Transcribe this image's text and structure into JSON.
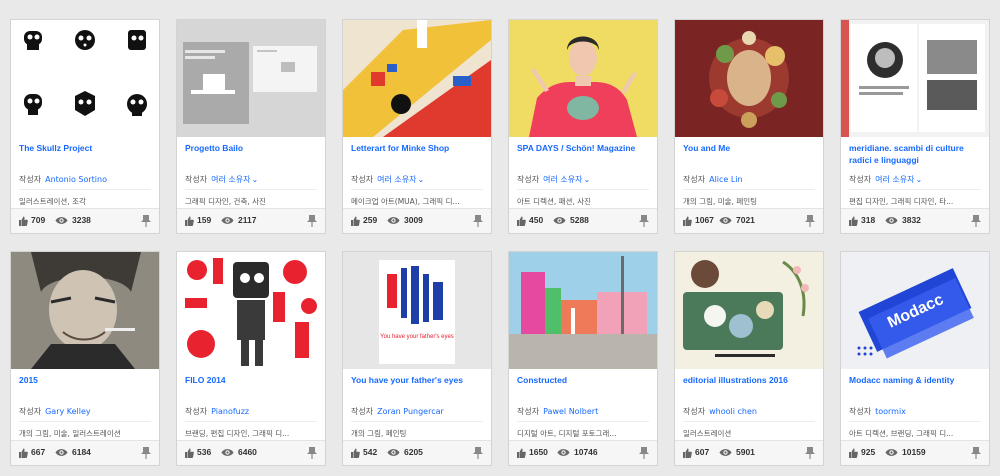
{
  "author_prefix": "작성자",
  "cards": [
    {
      "title": "The Skullz Project",
      "author": "Antonio Sortino",
      "multi": false,
      "fields": "일러스트레이션, 조각",
      "likes": "709",
      "views": "3238",
      "colors": {
        "bg": "#ffffff"
      }
    },
    {
      "title": "Progetto Bailo",
      "author": "여러 소유자",
      "multi": true,
      "fields": "그래픽 디자인, 건축, 사진",
      "likes": "159",
      "views": "2117",
      "colors": {
        "bg": "#d9d9d9"
      }
    },
    {
      "title": "Letterart for Minke Shop",
      "author": "여러 소유자",
      "multi": true,
      "fields": "메이크업 아트(MUA), 그래픽 디...",
      "likes": "259",
      "views": "3009",
      "colors": {
        "bg": "#efe4cf"
      }
    },
    {
      "title": "SPA DAYS / Schön! Magazine",
      "author": "여러 소유자",
      "multi": true,
      "fields": "아트 디렉션, 패션, 사진",
      "likes": "450",
      "views": "5288",
      "colors": {
        "bg": "#f0dc62"
      }
    },
    {
      "title": "You and Me",
      "author": "Alice Lin",
      "multi": false,
      "fields": "개의 그림, 미술, 페인팅",
      "likes": "1067",
      "views": "7021",
      "colors": {
        "bg": "#8a2a2a"
      }
    },
    {
      "title": "meridiane. scambi di culture radici e linguaggi",
      "author": "여러 소유자",
      "multi": true,
      "fields": "편집 디자인, 그래픽 디자인, 타...",
      "likes": "318",
      "views": "3832",
      "colors": {
        "bg": "#f2f2f2"
      }
    },
    {
      "title": "2015",
      "author": "Gary Kelley",
      "multi": false,
      "fields": "개의 그림, 미술, 일러스트레이션",
      "likes": "667",
      "views": "6184",
      "colors": {
        "bg": "#6d6a60"
      }
    },
    {
      "title": "FILO 2014",
      "author": "Pianofuzz",
      "multi": false,
      "fields": "브랜딩, 편집 디자인, 그래픽 디...",
      "likes": "536",
      "views": "6460",
      "colors": {
        "bg": "#ffffff"
      }
    },
    {
      "title": "You have your father's eyes",
      "author": "Zoran Pungercar",
      "multi": false,
      "fields": "개의 그림, 페인팅",
      "likes": "542",
      "views": "6205",
      "colors": {
        "bg": "#e6e6e6"
      }
    },
    {
      "title": "Constructed",
      "author": "Pawel Nolbert",
      "multi": false,
      "fields": "디지털 아트, 디지털 포토그래...",
      "likes": "1650",
      "views": "10746",
      "colors": {
        "bg": "#9ed0ea"
      }
    },
    {
      "title": "editorial illustrations 2016",
      "author": "whooli chen",
      "multi": false,
      "fields": "일러스트레이션",
      "likes": "607",
      "views": "5901",
      "colors": {
        "bg": "#f3efe1"
      }
    },
    {
      "title": "Modacc naming & identity",
      "author": "toormix",
      "multi": false,
      "fields": "아트 디렉션, 브랜딩, 그래픽 디...",
      "likes": "925",
      "views": "10159",
      "colors": {
        "bg": "#eef0f4"
      }
    }
  ],
  "art_text": {
    "father_caption": "You have your father's eyes",
    "modacc_wordmark": "Modacc"
  },
  "accent_color": "#1769ff"
}
